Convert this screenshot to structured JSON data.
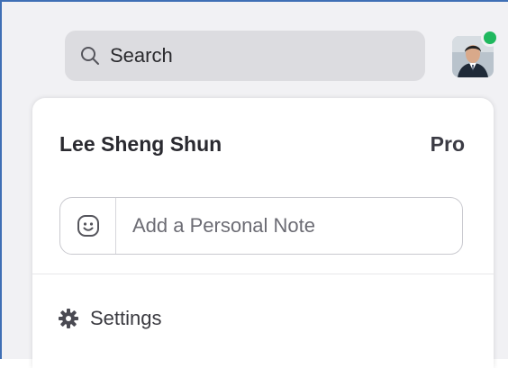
{
  "search": {
    "placeholder": "Search",
    "icon": "search-icon"
  },
  "avatar": {
    "icon": "avatar",
    "status_color": "#1fb85e"
  },
  "profile": {
    "name": "Lee Sheng Shun",
    "plan": "Pro"
  },
  "note": {
    "placeholder": "Add a Personal Note",
    "icon": "smiley-icon"
  },
  "menu": {
    "settings_label": "Settings",
    "settings_icon": "gear-icon"
  },
  "colors": {
    "accent_border": "#3f6fb5",
    "status_online": "#1fb85e"
  }
}
